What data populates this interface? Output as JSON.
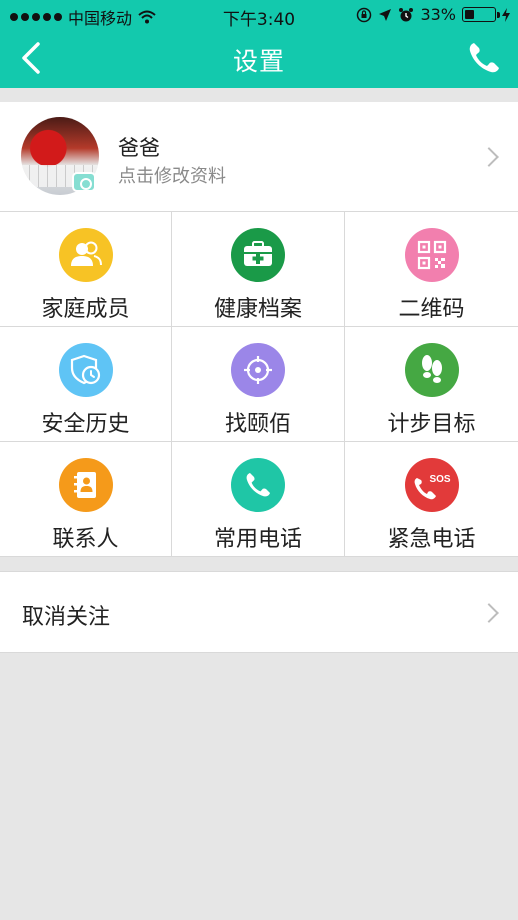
{
  "status_bar": {
    "carrier": "中国移动",
    "time": "下午3:40",
    "battery": "33%",
    "battery_level": 0.33
  },
  "nav": {
    "title": "设置"
  },
  "profile": {
    "name": "爸爸",
    "subtitle": "点击修改资料"
  },
  "grid": {
    "items": [
      {
        "label": "家庭成员",
        "icon": "family-members-icon",
        "color": "#f7c325"
      },
      {
        "label": "健康档案",
        "icon": "health-record-icon",
        "color": "#1a9a48"
      },
      {
        "label": "二维码",
        "icon": "qr-code-icon",
        "color": "#f27fae"
      },
      {
        "label": "安全历史",
        "icon": "safety-history-icon",
        "color": "#5fc4f5"
      },
      {
        "label": "找颐佰",
        "icon": "locate-icon",
        "color": "#9b86e8"
      },
      {
        "label": "计步目标",
        "icon": "footsteps-icon",
        "color": "#45a843"
      },
      {
        "label": "联系人",
        "icon": "contacts-icon",
        "color": "#f59a1a"
      },
      {
        "label": "常用电话",
        "icon": "phone-icon",
        "color": "#1fc6a6"
      },
      {
        "label": "紧急电话",
        "icon": "sos-phone-icon",
        "color": "#e23a3a"
      }
    ],
    "sos_text": "SOS"
  },
  "unfollow": {
    "label": "取消关注"
  },
  "colors": {
    "accent": "#13c9ad",
    "background": "#e6e6e6"
  }
}
